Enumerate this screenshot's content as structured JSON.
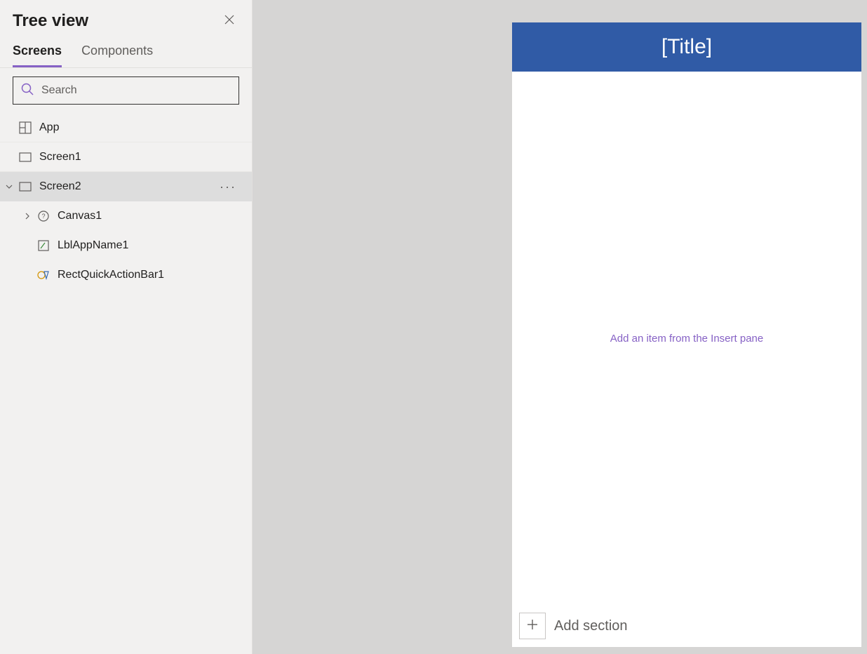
{
  "sidebar": {
    "title": "Tree view",
    "tabs": {
      "screens": "Screens",
      "components": "Components"
    },
    "search_placeholder": "Search",
    "items": {
      "app": "App",
      "screen1": "Screen1",
      "screen2": "Screen2",
      "canvas1": "Canvas1",
      "lblAppName1": "LblAppName1",
      "rectQuickActionBar1": "RectQuickActionBar1"
    }
  },
  "canvas": {
    "title": "[Title]",
    "placeholder": "Add an item from the Insert pane",
    "add_section": "Add section"
  }
}
